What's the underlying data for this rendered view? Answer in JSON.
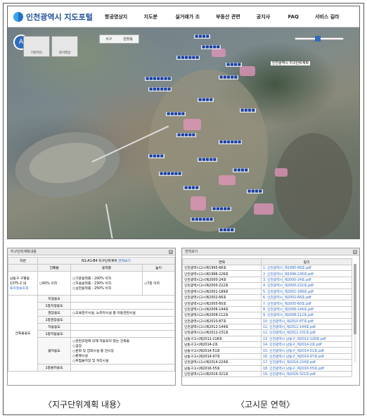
{
  "header": {
    "logo_text": "인천광역시 지도포털",
    "nav": [
      "항공영상지도",
      "지도분할",
      "실거래가 조회",
      "부동산 관련업",
      "공지사항",
      "FAQ",
      "서비스 길라잡이"
    ]
  },
  "map": {
    "thumbs": [
      "기본지도",
      "과거영상"
    ],
    "crumbs": [
      "서구",
      "원창동"
    ],
    "legend_btn": "A",
    "title_box": "인천광역시 지구단위계획"
  },
  "left_panel": {
    "title": "지구단위계획내용",
    "code": "N1-A1-B4 지구단위계획",
    "history_link": "연혁보기",
    "row_label": "지번",
    "cols": [
      "건폐율",
      "용적률",
      "높이"
    ],
    "address": "남동구 구월동 1375-2 대",
    "address_link": "토지정보조회",
    "bcr": "○60% 이하",
    "far": [
      "○기준용적률 : 200% 이하",
      "○허용용적률 : 230% 이하",
      "○상한용적률 : 250% 이하"
    ],
    "height": "○7층 이하",
    "use_label": "건축물용도",
    "uses": [
      {
        "k": "지정용도",
        "v": ""
      },
      {
        "k": "1층지정용도",
        "v": ""
      },
      {
        "k": "권장용도",
        "v": "○교육연구시설, 노유자시설 중 아동관련시설"
      },
      {
        "k": "1층권장용도",
        "v": ""
      },
      {
        "k": "허용용도",
        "v": ""
      },
      {
        "k": "1층허용용도",
        "v": ""
      },
      {
        "k": "불허용도",
        "v": "○관련규정에 의해 허용되지 않는 건축물\n○공장\n○문화 및 집회시설 중 전시장\n○판매시설\n○위험물저장 및 처리시설"
      },
      {
        "k": "1층불허용도",
        "v": ""
      }
    ]
  },
  "right_panel": {
    "title": "연혁보기",
    "cols": [
      "연혁",
      "링크"
    ],
    "rows": [
      [
        "인천광역시고시제1995-66호",
        "1. 인천광역시_제1995-66호.pdf"
      ],
      [
        "인천광역시고시제1996-226호",
        "2. 인천광역시_제1996-226호.pdf"
      ],
      [
        "인천광역시고시제2000-24호",
        "3. 인천광역시_제2000-24호.pdf"
      ],
      [
        "인천광역시고시제2000-222호",
        "4. 인천광역시_제2000-222호.pdf"
      ],
      [
        "인천광역시고시제2001-189호",
        "5. 인천광역시_제2001-189호.pdf"
      ],
      [
        "인천광역시고시제2002-66호",
        "6. 인천광역시_제2002-66호.pdf"
      ],
      [
        "인천광역시고시제2005-60호",
        "7. 인천광역시_제2005-60호.pdf"
      ],
      [
        "인천광역시고시제2006-144호",
        "8. 인천광역시_제2006-144호.pdf"
      ],
      [
        "인천광역시고시제2008-112호",
        "9. 인천광역시_제2008-112호.pdf"
      ],
      [
        "인천광역시고시제2010-87호",
        "10. 인천광역시_제2010-87호.pdf"
      ],
      [
        "인천광역시고시제2012-144호",
        "11. 인천광역시_제2012-144호.pdf"
      ],
      [
        "인천광역시고시제2012-231호",
        "12. 인천광역시_제2012-231호.pdf"
      ],
      [
        "남동구고시제2012-218호",
        "13. 인천광역시 남동구_제2012-128호.pdf"
      ],
      [
        "남동구고시제2014-2호",
        "14. 인천광역시 남동구_제2014-2호.pdf"
      ],
      [
        "남동구고시제2014-51호",
        "15. 인천광역시 남동구_제2014-51호.pdf"
      ],
      [
        "남동구고시제2014-97호",
        "16. 인천광역시 남동구_제2014-97호.pdf"
      ],
      [
        "인천광역시고시제2014-224호",
        "17. 인천광역시_제2014-224호.pdf"
      ],
      [
        "남동구고시제2016-55호",
        "18. 인천광역시 남동구_제2016-55호.pdf"
      ],
      [
        "인천광역시고시제2016-321호",
        "19. 인천광역시_제2016-321호.pdf"
      ]
    ]
  },
  "captions": {
    "left": "〈지구단위계획 내용〉",
    "right": "〈고시문 연혁〉"
  }
}
